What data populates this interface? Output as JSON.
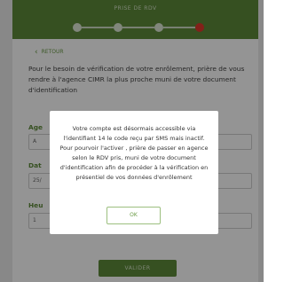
{
  "header": {
    "title": "PRISE DE RDV",
    "steps": 4,
    "active_step": 4
  },
  "back": {
    "label": "RETOUR"
  },
  "intro": "Pour le besoin de vérification de votre enrôlement, prière de vous rendre à l'agence CIMR la plus proche muni de votre document d'identification",
  "fields": {
    "agence": {
      "label": "Age",
      "value": "A"
    },
    "date": {
      "label": "Dat",
      "value": "25/"
    },
    "heure": {
      "label": "Heu",
      "value": "1"
    }
  },
  "validate_label": "VALIDER",
  "modal": {
    "message": "Votre compte est désormais accessible via l'identifiant 14 le code reçu par SMS mais inactif. Pour pourvoir l'activer , prière de passer en agence selon le RDV pris, muni de votre document d'identification afin de procéder à la vérification en présentiel de vos données d'enrôlement",
    "ok_label": "OK"
  },
  "colors": {
    "header": "#5e8a3a",
    "active_step": "#e0392b",
    "accent": "#6a9a45"
  }
}
